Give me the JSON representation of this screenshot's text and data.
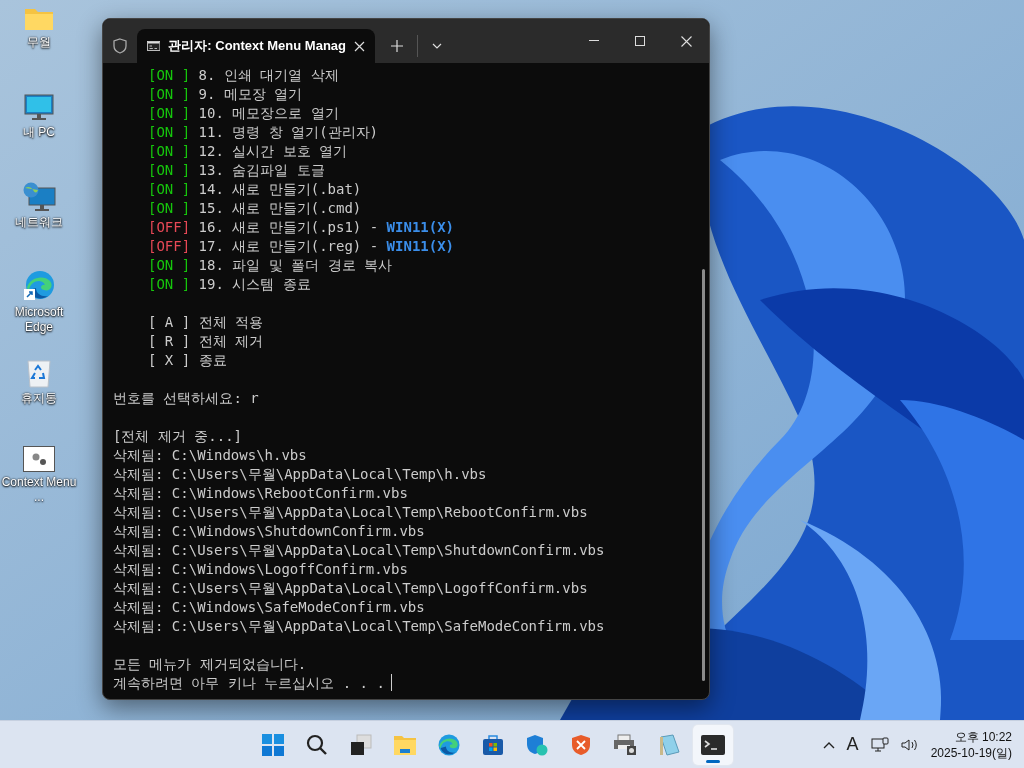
{
  "desktop_icons": [
    {
      "kind": "folder",
      "label": "무월"
    },
    {
      "kind": "pc",
      "label": "내 PC"
    },
    {
      "kind": "network",
      "label": "네트워크"
    },
    {
      "kind": "edge",
      "label": "Microsoft Edge"
    },
    {
      "kind": "recycle",
      "label": "휴지통"
    },
    {
      "kind": "app",
      "label": "Context Menu ..."
    }
  ],
  "window": {
    "title": "관리자: Context Menu Manag"
  },
  "terminal": {
    "menu_items": [
      {
        "status": "[ON ]",
        "on": true,
        "number": "8.",
        "label": "인쇄 대기열 삭제"
      },
      {
        "status": "[ON ]",
        "on": true,
        "number": "9.",
        "label": "메모장 열기"
      },
      {
        "status": "[ON ]",
        "on": true,
        "number": "10.",
        "label": "메모장으로 열기"
      },
      {
        "status": "[ON ]",
        "on": true,
        "number": "11.",
        "label": "명령 창 열기(관리자)"
      },
      {
        "status": "[ON ]",
        "on": true,
        "number": "12.",
        "label": "실시간 보호 열기"
      },
      {
        "status": "[ON ]",
        "on": true,
        "number": "13.",
        "label": "숨김파일 토글"
      },
      {
        "status": "[ON ]",
        "on": true,
        "number": "14.",
        "label": "새로 만들기(.bat)"
      },
      {
        "status": "[ON ]",
        "on": true,
        "number": "15.",
        "label": "새로 만들기(.cmd)"
      },
      {
        "status": "[OFF]",
        "on": false,
        "number": "16.",
        "label": "새로 만들기(.ps1) -",
        "note": "WIN11(X)"
      },
      {
        "status": "[OFF]",
        "on": false,
        "number": "17.",
        "label": "새로 만들기(.reg) -",
        "note": "WIN11(X)"
      },
      {
        "status": "[ON ]",
        "on": true,
        "number": "18.",
        "label": "파일 및 폴더 경로 복사"
      },
      {
        "status": "[ON ]",
        "on": true,
        "number": "19.",
        "label": "시스템 종료"
      }
    ],
    "options": [
      {
        "key": "[ A ]",
        "label": "전체 적용"
      },
      {
        "key": "[ R ]",
        "label": "전체 제거"
      },
      {
        "key": "[ X ]",
        "label": "종료"
      }
    ],
    "prompt": "번호를 선택하세요:",
    "input": "r",
    "log_header": "[전체 제거 중...]",
    "log": [
      "삭제됨: C:\\Windows\\h.vbs",
      "삭제됨: C:\\Users\\무월\\AppData\\Local\\Temp\\h.vbs",
      "삭제됨: C:\\Windows\\RebootConfirm.vbs",
      "삭제됨: C:\\Users\\무월\\AppData\\Local\\Temp\\RebootConfirm.vbs",
      "삭제됨: C:\\Windows\\ShutdownConfirm.vbs",
      "삭제됨: C:\\Users\\무월\\AppData\\Local\\Temp\\ShutdownConfirm.vbs",
      "삭제됨: C:\\Windows\\LogoffConfirm.vbs",
      "삭제됨: C:\\Users\\무월\\AppData\\Local\\Temp\\LogoffConfirm.vbs",
      "삭제됨: C:\\Windows\\SafeModeConfirm.vbs",
      "삭제됨: C:\\Users\\무월\\AppData\\Local\\Temp\\SafeModeConfirm.vbs"
    ],
    "result": "모든 메뉴가 제거되었습니다.",
    "pause": "계속하려면 아무 키나 누르십시오 . . ."
  },
  "taskbar": {
    "apps": [
      {
        "kind": "start",
        "selected": false
      },
      {
        "kind": "search",
        "selected": false
      },
      {
        "kind": "taskview",
        "selected": false
      },
      {
        "kind": "explorer",
        "selected": false
      },
      {
        "kind": "edge",
        "selected": false
      },
      {
        "kind": "store",
        "selected": false
      },
      {
        "kind": "security",
        "selected": false
      },
      {
        "kind": "shield",
        "selected": false
      },
      {
        "kind": "printer",
        "selected": false
      },
      {
        "kind": "notepad",
        "selected": false
      },
      {
        "kind": "terminal",
        "selected": true
      }
    ],
    "ime": "A",
    "time": "오후 10:22",
    "date": "2025-10-19(일)"
  }
}
